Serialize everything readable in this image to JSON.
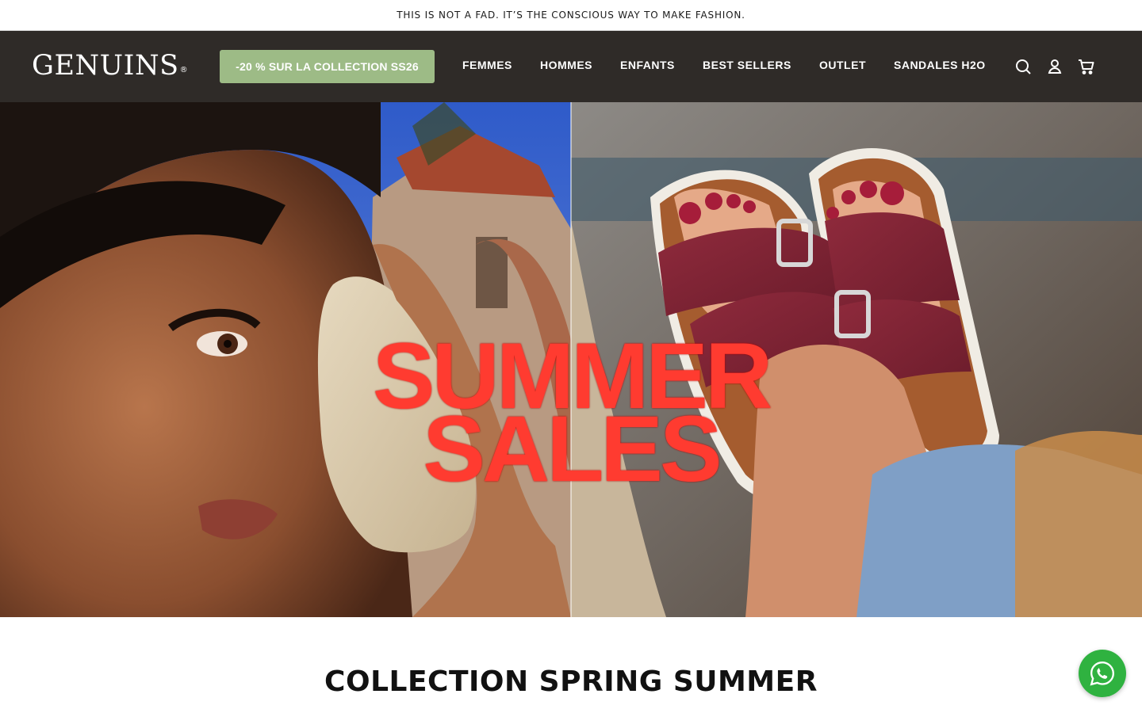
{
  "announcement": {
    "text": "THIS IS NOT A FAD. IT’S THE CONSCIOUS WAY TO MAKE FASHION."
  },
  "header": {
    "logo": "GENUINS",
    "logo_mark": "®",
    "promo_label": "-20 % SUR LA COLLECTION SS26",
    "nav": [
      "FEMMES",
      "HOMMES",
      "ENFANTS",
      "BEST SELLERS",
      "OUTLET",
      "SANDALES H2O"
    ],
    "icons": [
      "search-icon",
      "account-icon",
      "cart-icon"
    ],
    "colors": {
      "header_bg": "#2f2b28",
      "promo_bg": "#9dbb86"
    }
  },
  "hero": {
    "title_line1": "SUMMER",
    "title_line2": "SALES",
    "title_color": "#ff3b30"
  },
  "main": {
    "section_title": "COLLECTION SPRING SUMMER"
  },
  "chat": {
    "icon": "whatsapp-icon",
    "color": "#2fb240"
  }
}
